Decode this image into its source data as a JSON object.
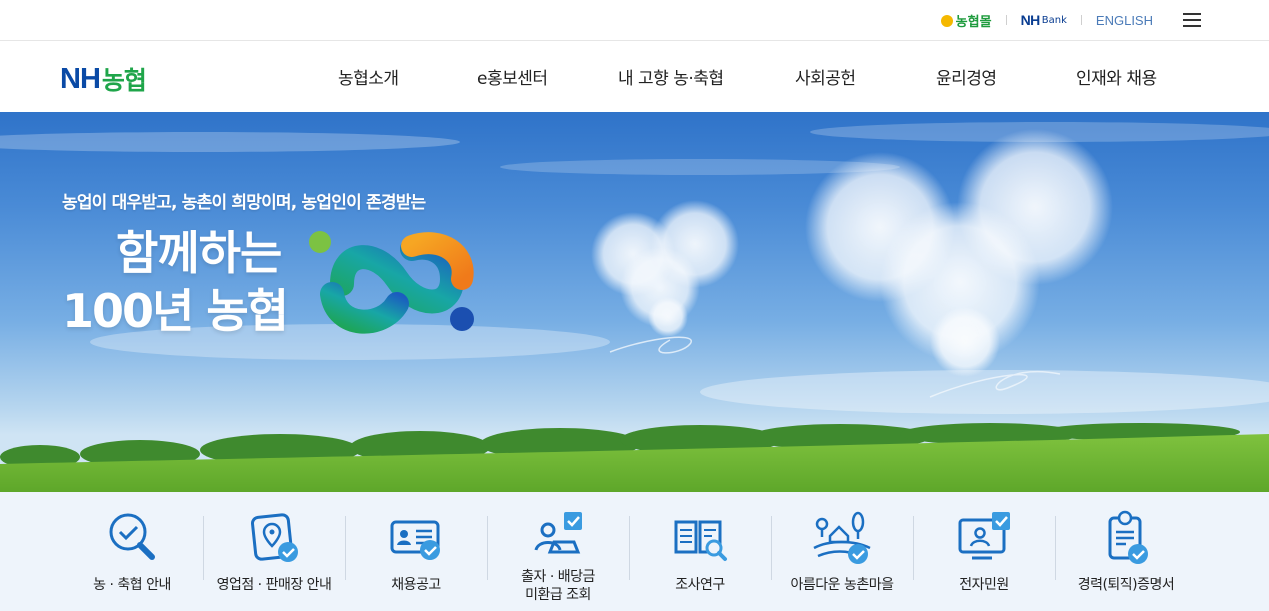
{
  "util_bar": {
    "mall_label": "농협몰",
    "bank_label_main": "NH",
    "bank_label_sub": "Bank",
    "english_label": "ENGLISH",
    "menu_icon": "hamburger-menu-icon"
  },
  "header": {
    "logo_nh": "NH",
    "logo_kr": "농협",
    "nav": [
      "농협소개",
      "e홍보센터",
      "내 고향 농·축협",
      "사회공헌",
      "윤리경영",
      "인재와 채용"
    ]
  },
  "hero": {
    "slogan": "농업이 대우받고, 농촌이 희망이며, 농업인이 존경받는",
    "headline_line1": "함께하는",
    "headline_line2": "100년 농협"
  },
  "quick_menu": [
    {
      "label": "농 · 축협 안내",
      "icon": "search-check-icon"
    },
    {
      "label": "영업점 · 판매장 안내",
      "icon": "map-pin-icon"
    },
    {
      "label": "채용공고",
      "icon": "id-card-icon"
    },
    {
      "label_line1": "출자 · 배당금",
      "label_line2": "미환급 조회",
      "icon": "person-laptop-icon"
    },
    {
      "label": "조사연구",
      "icon": "book-search-icon"
    },
    {
      "label": "아름다운 농촌마을",
      "icon": "village-icon"
    },
    {
      "label": "전자민원",
      "icon": "monitor-person-icon"
    },
    {
      "label": "경력(퇴직)증명서",
      "icon": "certificate-icon"
    }
  ],
  "colors": {
    "brand_blue": "#0a4aa6",
    "brand_green": "#1fa54a",
    "icon_blue": "#1b6fc2",
    "quick_bg": "#eef4fb"
  }
}
